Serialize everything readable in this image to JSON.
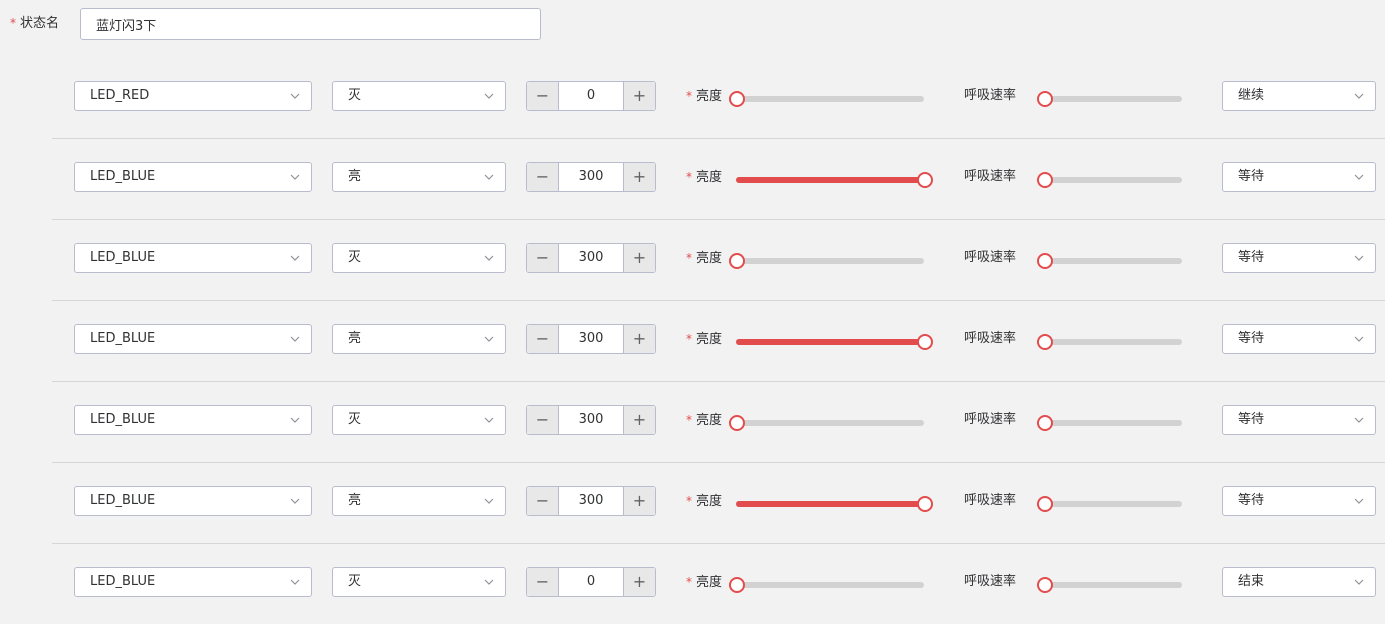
{
  "state_name": {
    "required_mark": "*",
    "label": "状态名",
    "value": "蓝灯闪3下"
  },
  "rows": [
    {
      "led": "LED_RED",
      "switch": "灭",
      "duration": "0",
      "brightness_label": "亮度",
      "brightness": 0,
      "breath_label": "呼吸速率",
      "breath": 0,
      "action": "继续"
    },
    {
      "led": "LED_BLUE",
      "switch": "亮",
      "duration": "300",
      "brightness_label": "亮度",
      "brightness": 100,
      "breath_label": "呼吸速率",
      "breath": 0,
      "action": "等待"
    },
    {
      "led": "LED_BLUE",
      "switch": "灭",
      "duration": "300",
      "brightness_label": "亮度",
      "brightness": 0,
      "breath_label": "呼吸速率",
      "breath": 0,
      "action": "等待"
    },
    {
      "led": "LED_BLUE",
      "switch": "亮",
      "duration": "300",
      "brightness_label": "亮度",
      "brightness": 100,
      "breath_label": "呼吸速率",
      "breath": 0,
      "action": "等待"
    },
    {
      "led": "LED_BLUE",
      "switch": "灭",
      "duration": "300",
      "brightness_label": "亮度",
      "brightness": 0,
      "breath_label": "呼吸速率",
      "breath": 0,
      "action": "等待"
    },
    {
      "led": "LED_BLUE",
      "switch": "亮",
      "duration": "300",
      "brightness_label": "亮度",
      "brightness": 100,
      "breath_label": "呼吸速率",
      "breath": 0,
      "action": "等待"
    },
    {
      "led": "LED_BLUE",
      "switch": "灭",
      "duration": "0",
      "brightness_label": "亮度",
      "brightness": 0,
      "breath_label": "呼吸速率",
      "breath": 0,
      "action": "结束"
    }
  ],
  "stepper": {
    "minus": "−",
    "plus": "+"
  },
  "icons": {
    "dropdown": "chevron-down-icon",
    "decrement": "minus-icon",
    "increment": "plus-icon"
  },
  "colors": {
    "accent": "#e24c4c",
    "track": "#d2d2d2",
    "border": "#b9bccc",
    "background": "#f2f2f2"
  }
}
